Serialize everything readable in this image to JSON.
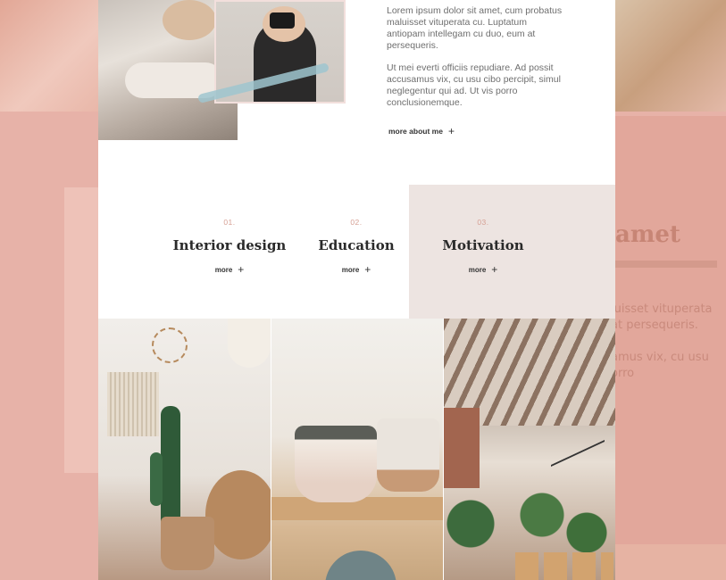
{
  "intro": {
    "paragraph1": "Lorem ipsum dolor sit amet, cum probatus maluisset vituperata cu. Luptatum antiopam intellegam cu duo, eum at persequeris.",
    "paragraph2": "Ut mei everti officiis repudiare. Ad possit accusamus vix, cu usu cibo percipit, simul neglegentur qui ad. Ut vis porro conclusionemque.",
    "more_label": "more about me",
    "more_icon": "plus-icon"
  },
  "features": [
    {
      "number": "01.",
      "title": "Interior design",
      "more_label": "more"
    },
    {
      "number": "02.",
      "title": "Education",
      "more_label": "more"
    },
    {
      "number": "03.",
      "title": "Motivation",
      "more_label": "more"
    }
  ],
  "background": {
    "word": "amet",
    "text_line1": "luisset vituperata",
    "text_line2": "at persequeris.",
    "text_line3": "amus vix, cu usu",
    "text_line4": "orro"
  },
  "colors": {
    "accent": "#d6a094",
    "overlay": "#e7b2a8",
    "feature_shade": "#ede4e1"
  }
}
